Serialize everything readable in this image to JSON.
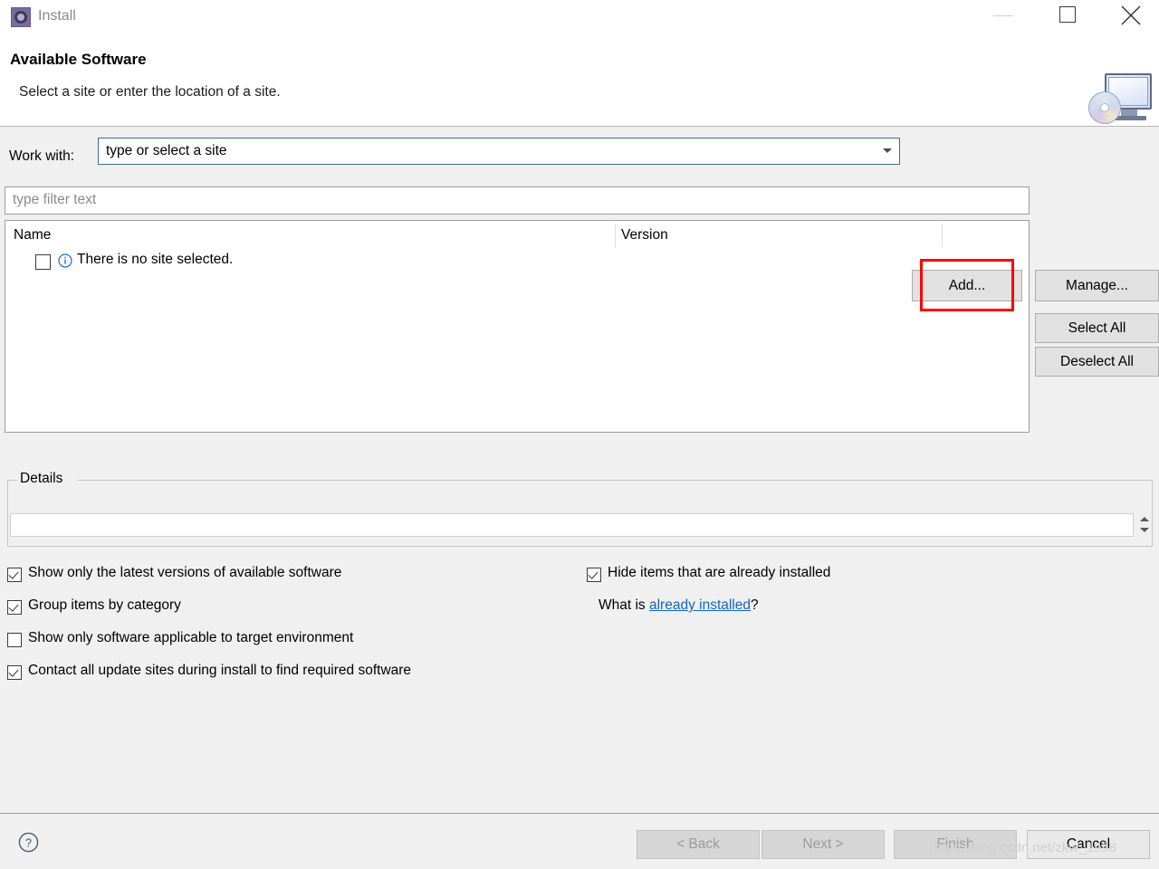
{
  "window": {
    "title": "Install",
    "icon": "install-gear-icon",
    "minimize_label": "",
    "maximize_label": "",
    "close_label": ""
  },
  "header": {
    "title": "Available Software",
    "subtitle": "Select a site or enter the location of a site."
  },
  "work_with": {
    "label": "Work with:",
    "value": "type or select a site",
    "placeholder": "type or select a site"
  },
  "filter": {
    "placeholder": "type filter text",
    "value": ""
  },
  "side_buttons": {
    "add": "Add...",
    "manage": "Manage...",
    "select_all": "Select All",
    "deselect_all": "Deselect All"
  },
  "table": {
    "columns": [
      "Name",
      "Version"
    ],
    "rows": [
      {
        "checked": false,
        "icon": "info-icon",
        "name": "There is no site selected.",
        "version": ""
      }
    ]
  },
  "details": {
    "legend": "Details",
    "value": ""
  },
  "options": {
    "left": [
      {
        "label": "Show only the latest versions of available software",
        "checked": true
      },
      {
        "label": "Group items by category",
        "checked": true
      },
      {
        "label": "Show only software applicable to target environment",
        "checked": false
      },
      {
        "label": "Contact all update sites during install to find required software",
        "checked": true
      }
    ],
    "right": [
      {
        "label": "Hide items that are already installed",
        "checked": true
      }
    ],
    "what_is_prefix": "What is ",
    "what_is_link": "already installed",
    "what_is_suffix": "?"
  },
  "footer": {
    "help": "?",
    "back": "< Back",
    "next": "Next >",
    "finish": "Finish",
    "cancel": "Cancel"
  },
  "watermark": "https://blog.csdn.net/zkw_1998",
  "colors": {
    "accent_focus_border": "#3c6d99",
    "highlight_rect": "#ff0000",
    "link": "#1565c0",
    "body_background": "#f0f0f0",
    "title_icon": "#7b6a9e"
  }
}
